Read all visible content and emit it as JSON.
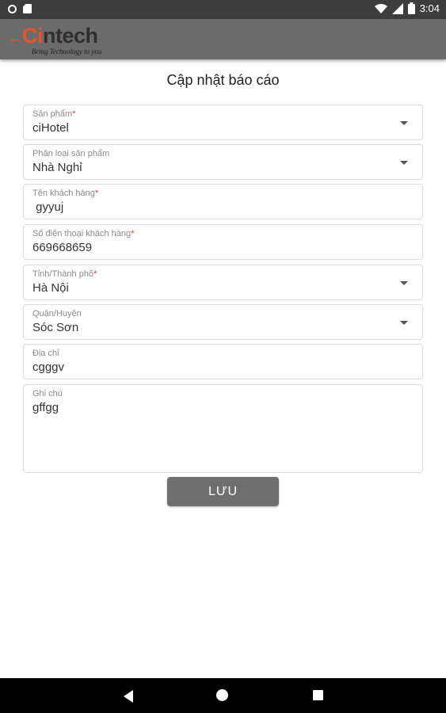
{
  "status_bar": {
    "time": "3:04",
    "icons": [
      "circle-notification-icon",
      "sd-card-icon",
      "wifi-icon",
      "signal-icon",
      "battery-icon"
    ]
  },
  "app_bar": {
    "logo_c": "Ci",
    "logo_rest": "ntech",
    "tagline": "Bring Technology to you",
    "colors": {
      "bar": "#6b6b6b",
      "brand": "#e8542c"
    }
  },
  "page": {
    "title": "Cập nhật báo cáo"
  },
  "form": {
    "product": {
      "label": "Sản phẩm",
      "required": "*",
      "value": "ciHotel"
    },
    "product_category": {
      "label": "Phân loại sản phẩm",
      "value": "Nhà Nghỉ"
    },
    "customer_name": {
      "label": "Tên khách hàng",
      "required": "*",
      "value": " gyyuj"
    },
    "customer_phone": {
      "label": "Số điện thoại khách hàng",
      "required": "*",
      "value": "669668659"
    },
    "province": {
      "label": "Tỉnh/Thành phố",
      "required": "*",
      "value": "Hà Nội"
    },
    "district": {
      "label": "Quận/Huyện",
      "value": "Sóc Sơn"
    },
    "address": {
      "label": "Địa chỉ",
      "value": "cgggv"
    },
    "note": {
      "label": "Ghi chú",
      "value": "gffgg"
    }
  },
  "save_button": {
    "label": "LƯU",
    "color": "#6f6f6f"
  }
}
